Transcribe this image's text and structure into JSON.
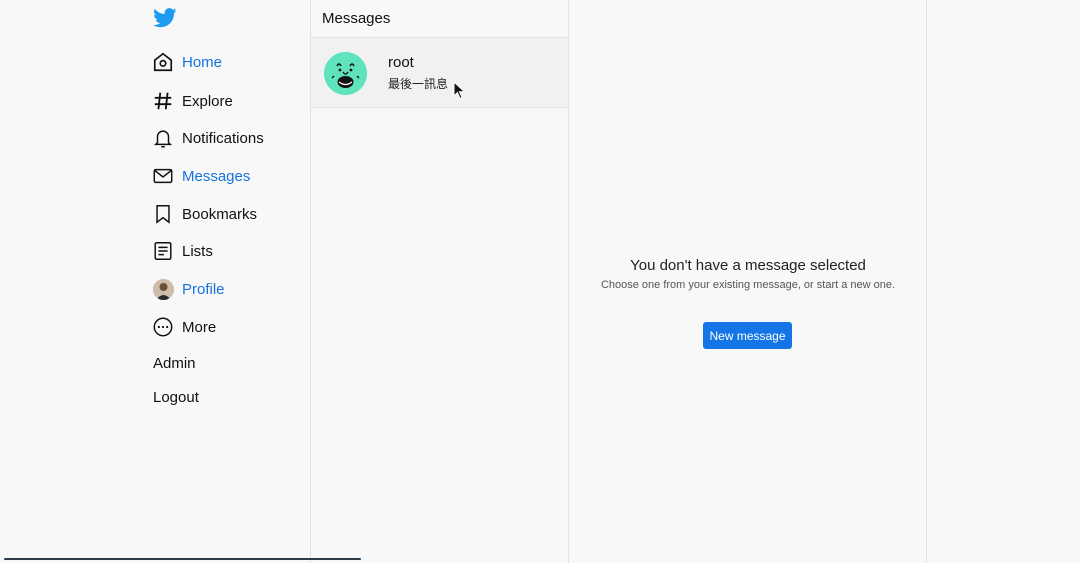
{
  "sidebar": {
    "logo_icon": "bird-logo-icon",
    "items": [
      {
        "label": "Home",
        "icon": "home-icon",
        "active": true
      },
      {
        "label": "Explore",
        "icon": "hash-icon",
        "active": false
      },
      {
        "label": "Notifications",
        "icon": "bell-icon",
        "active": false
      },
      {
        "label": "Messages",
        "icon": "mail-icon",
        "active": true
      },
      {
        "label": "Bookmarks",
        "icon": "bookmark-icon",
        "active": false
      },
      {
        "label": "Lists",
        "icon": "list-icon",
        "active": false
      },
      {
        "label": "Profile",
        "icon": "avatar",
        "active": true
      },
      {
        "label": "More",
        "icon": "more-icon",
        "active": false
      }
    ],
    "admin_label": "Admin",
    "logout_label": "Logout"
  },
  "messages": {
    "header": "Messages",
    "conversations": [
      {
        "name": "root",
        "preview": "最後一訊息"
      }
    ]
  },
  "detail": {
    "empty_title": "You don't have a message selected",
    "empty_subtitle": "Choose one from your existing message, or start a new one.",
    "new_message_label": "New message"
  },
  "colors": {
    "accent": "#1673e0",
    "button": "#1476e6",
    "background": "#f8f8f8"
  }
}
